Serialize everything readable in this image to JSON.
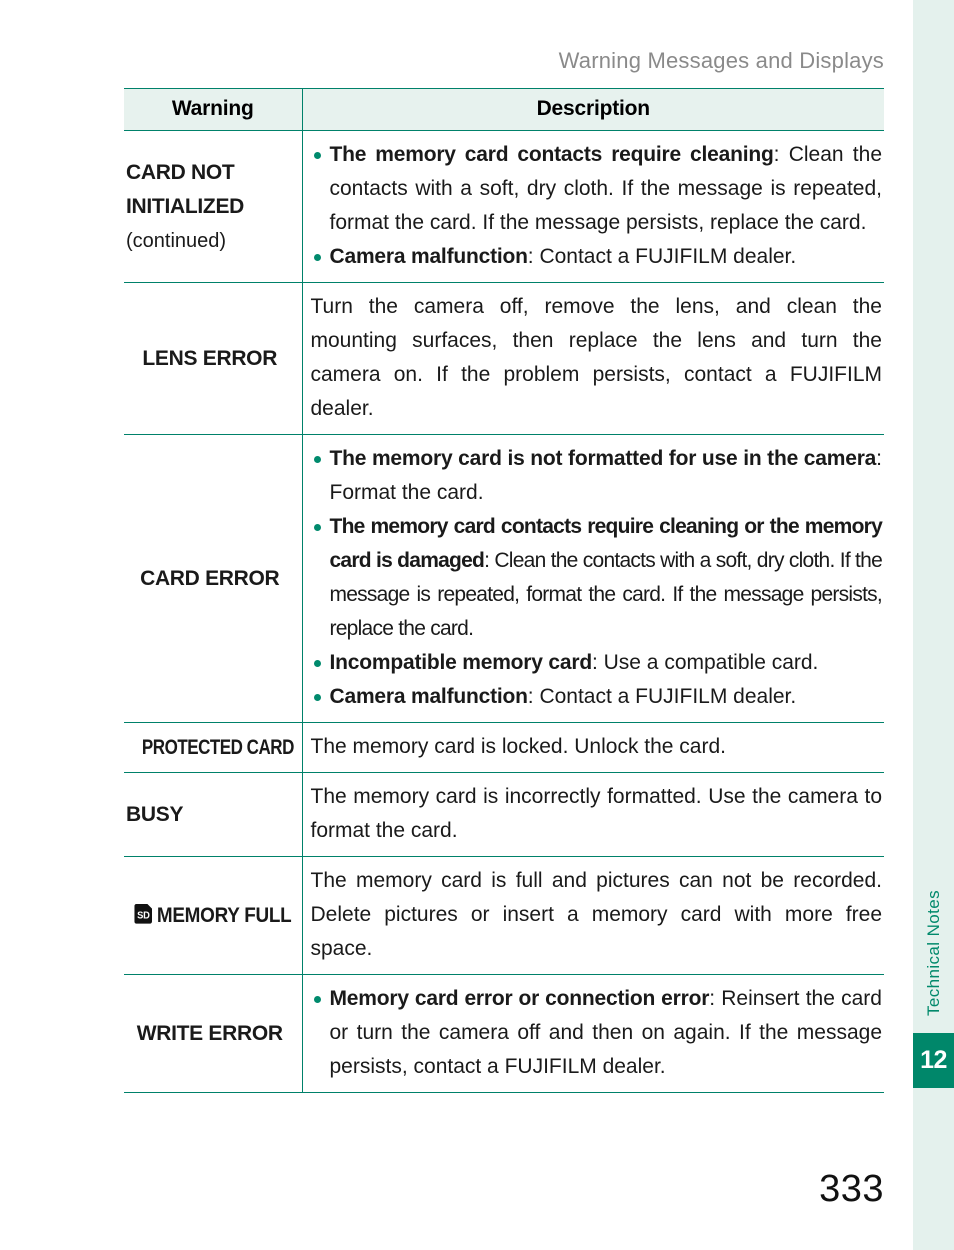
{
  "header": {
    "running_title": "Warning Messages and Displays"
  },
  "sidebar": {
    "chapter_label": "Technical Notes",
    "chapter_number": "12",
    "accent_color": "#00876a",
    "strip_color": "#e4f1ed"
  },
  "table": {
    "columns": {
      "warning": "Warning",
      "description": "Description"
    },
    "rows": [
      {
        "warning": "CARD NOT INITIALIZED",
        "warning_note": "(continued)",
        "items": [
          {
            "bold": "The memory card contacts require cleaning",
            "rest": ": Clean the contacts with a soft, dry cloth. If the message is repeated, format the card. If the message persists, replace the card."
          },
          {
            "bold": "Camera malfunction",
            "rest": ": Contact a FUJIFILM dealer."
          }
        ]
      },
      {
        "warning": "LENS ERROR",
        "paragraph": "Turn the camera off, remove the lens, and clean the mounting surfaces, then replace the lens and turn the camera on. If the problem persists, contact a FUJIFILM dealer."
      },
      {
        "warning": "CARD ERROR",
        "items": [
          {
            "bold": "The memory card is not formatted for use in the camera",
            "rest": ": Format the card."
          },
          {
            "bold": "The memory card contacts require cleaning or the memory card is damaged",
            "rest": ": Clean the contacts with a soft, dry cloth. If the message is repeated, format the card. If the message persists, replace the card."
          },
          {
            "bold": "Incompatible memory card",
            "rest": ": Use a compatible card."
          },
          {
            "bold": "Camera malfunction",
            "rest": ": Contact a FUJIFILM dealer."
          }
        ]
      },
      {
        "warning": "PROTECTED CARD",
        "paragraph": "The memory card is locked. Unlock the card."
      },
      {
        "warning": "BUSY",
        "paragraph": "The memory card is incorrectly formatted. Use the camera to format the card."
      },
      {
        "warning": "MEMORY FULL",
        "warning_icon": "sd-card-icon",
        "paragraph": "The memory card is full and pictures can not be recorded. Delete pictures or insert a memory card with more free space."
      },
      {
        "warning": "WRITE ERROR",
        "items": [
          {
            "bold": "Memory card error or connection error",
            "rest": ": Reinsert the card or turn the camera off and then on again. If the message persists, contact a FUJIFILM dealer."
          }
        ]
      }
    ]
  },
  "footer": {
    "page_number": "333"
  }
}
